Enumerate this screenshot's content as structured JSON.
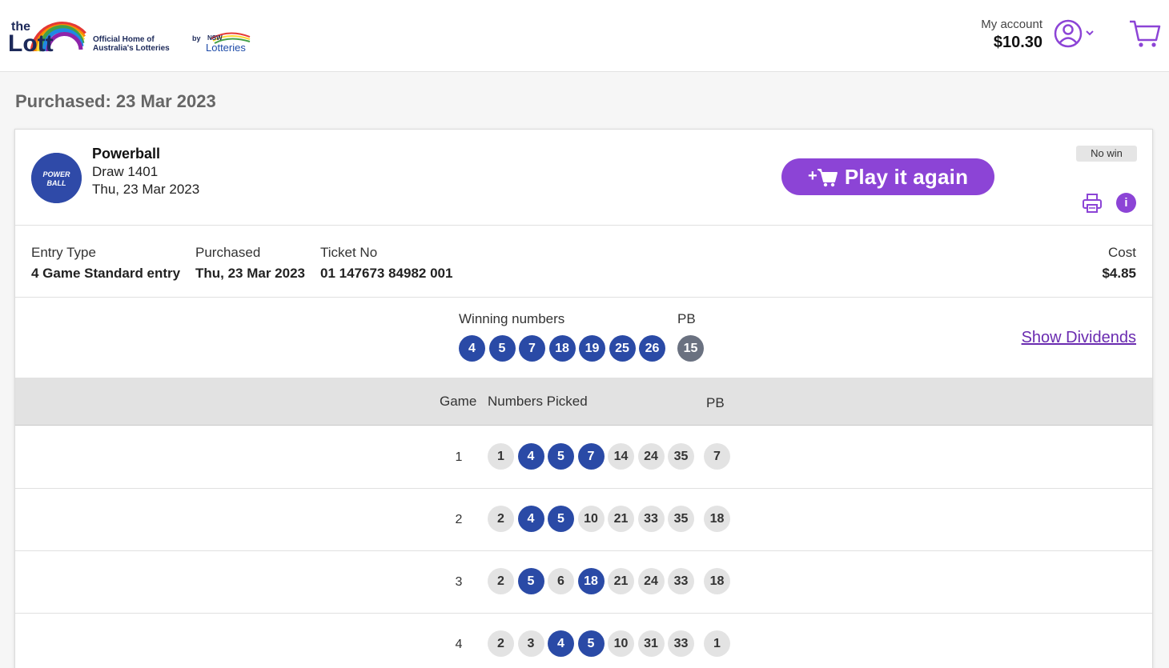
{
  "header": {
    "logo_text": "the Lott",
    "tagline_line1": "Official Home of",
    "tagline_line2": "Australia's Lotteries",
    "by": "by",
    "nsw_logo_text": "NSW Lotteries",
    "account_label": "My account",
    "account_balance": "$10.30",
    "avatar_icon": "user-circle-icon",
    "cart_icon": "shopping-cart-icon"
  },
  "page": {
    "purchased_heading": "Purchased: 23 Mar 2023"
  },
  "ticket": {
    "game_name": "Powerball",
    "game_logo_text": "POWERBALL",
    "draw": "Draw 1401",
    "draw_date": "Thu, 23 Mar 2023",
    "play_again_label": "Play it again",
    "status": "No win",
    "info_label": "i",
    "entry_type_label": "Entry Type",
    "entry_type_value": "4 Game Standard entry",
    "purchased_label": "Purchased",
    "purchased_value": "Thu, 23 Mar 2023",
    "ticket_no_label": "Ticket No",
    "ticket_no_value": "01 147673 84982 001",
    "cost_label": "Cost",
    "cost_value": "$4.85"
  },
  "results": {
    "winning_label": "Winning numbers",
    "pb_label": "PB",
    "winning_numbers": [
      "4",
      "5",
      "7",
      "18",
      "19",
      "25",
      "26"
    ],
    "winning_pb": "15",
    "show_dividends_label": "Show Dividends"
  },
  "games_table": {
    "headers": {
      "game": "Game",
      "numbers": "Numbers Picked",
      "pb": "PB"
    },
    "rows": [
      {
        "game": "1",
        "numbers": [
          "1",
          "4",
          "5",
          "7",
          "14",
          "24",
          "35"
        ],
        "matched": [
          false,
          true,
          true,
          true,
          false,
          false,
          false
        ],
        "pb": "7"
      },
      {
        "game": "2",
        "numbers": [
          "2",
          "4",
          "5",
          "10",
          "21",
          "33",
          "35"
        ],
        "matched": [
          false,
          true,
          true,
          false,
          false,
          false,
          false
        ],
        "pb": "18"
      },
      {
        "game": "3",
        "numbers": [
          "2",
          "5",
          "6",
          "18",
          "21",
          "24",
          "33"
        ],
        "matched": [
          false,
          true,
          false,
          true,
          false,
          false,
          false
        ],
        "pb": "18"
      },
      {
        "game": "4",
        "numbers": [
          "2",
          "3",
          "4",
          "5",
          "10",
          "31",
          "33"
        ],
        "matched": [
          false,
          false,
          true,
          true,
          false,
          false,
          false
        ],
        "pb": "1"
      }
    ]
  },
  "colors": {
    "accent": "#8c44d6",
    "match_ball": "#2a4aa6",
    "pb_ball": "#6a7180",
    "plain_ball": "#e3e3e3"
  }
}
